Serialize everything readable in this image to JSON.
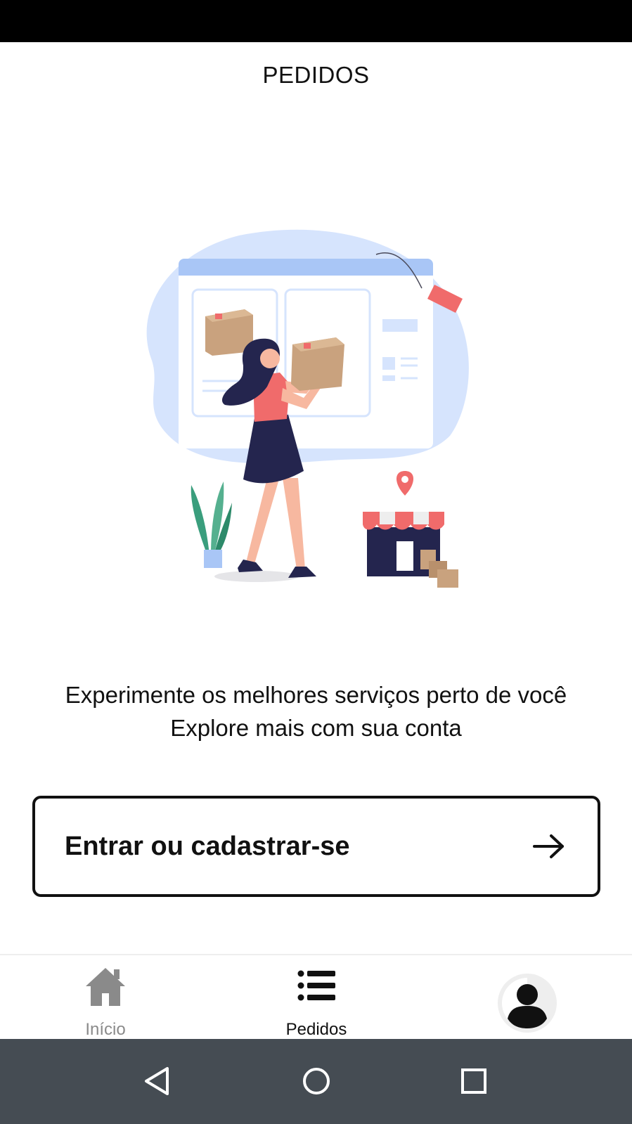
{
  "header": {
    "title": "PEDIDOS"
  },
  "tagline": {
    "line1": "Experimente os melhores serviços perto de você",
    "line2": "Explore mais com sua conta"
  },
  "cta": {
    "label": "Entrar ou cadastrar-se",
    "icon": "arrow-right-icon"
  },
  "bottom_nav": {
    "items": [
      {
        "label": "Início",
        "icon": "home-icon",
        "active": false
      },
      {
        "label": "Pedidos",
        "icon": "list-icon",
        "active": true
      },
      {
        "label": "",
        "icon": "avatar-icon",
        "active": false
      }
    ]
  },
  "system_nav": {
    "buttons": [
      "back-icon",
      "home-circle-icon",
      "recents-icon"
    ]
  },
  "colors": {
    "blob": "#d6e4fd",
    "window_bar": "#a9c6f6",
    "accent_red": "#f06b6b",
    "navy": "#24254e",
    "box": "#c9a27e",
    "system_nav_bg": "#454c53"
  }
}
